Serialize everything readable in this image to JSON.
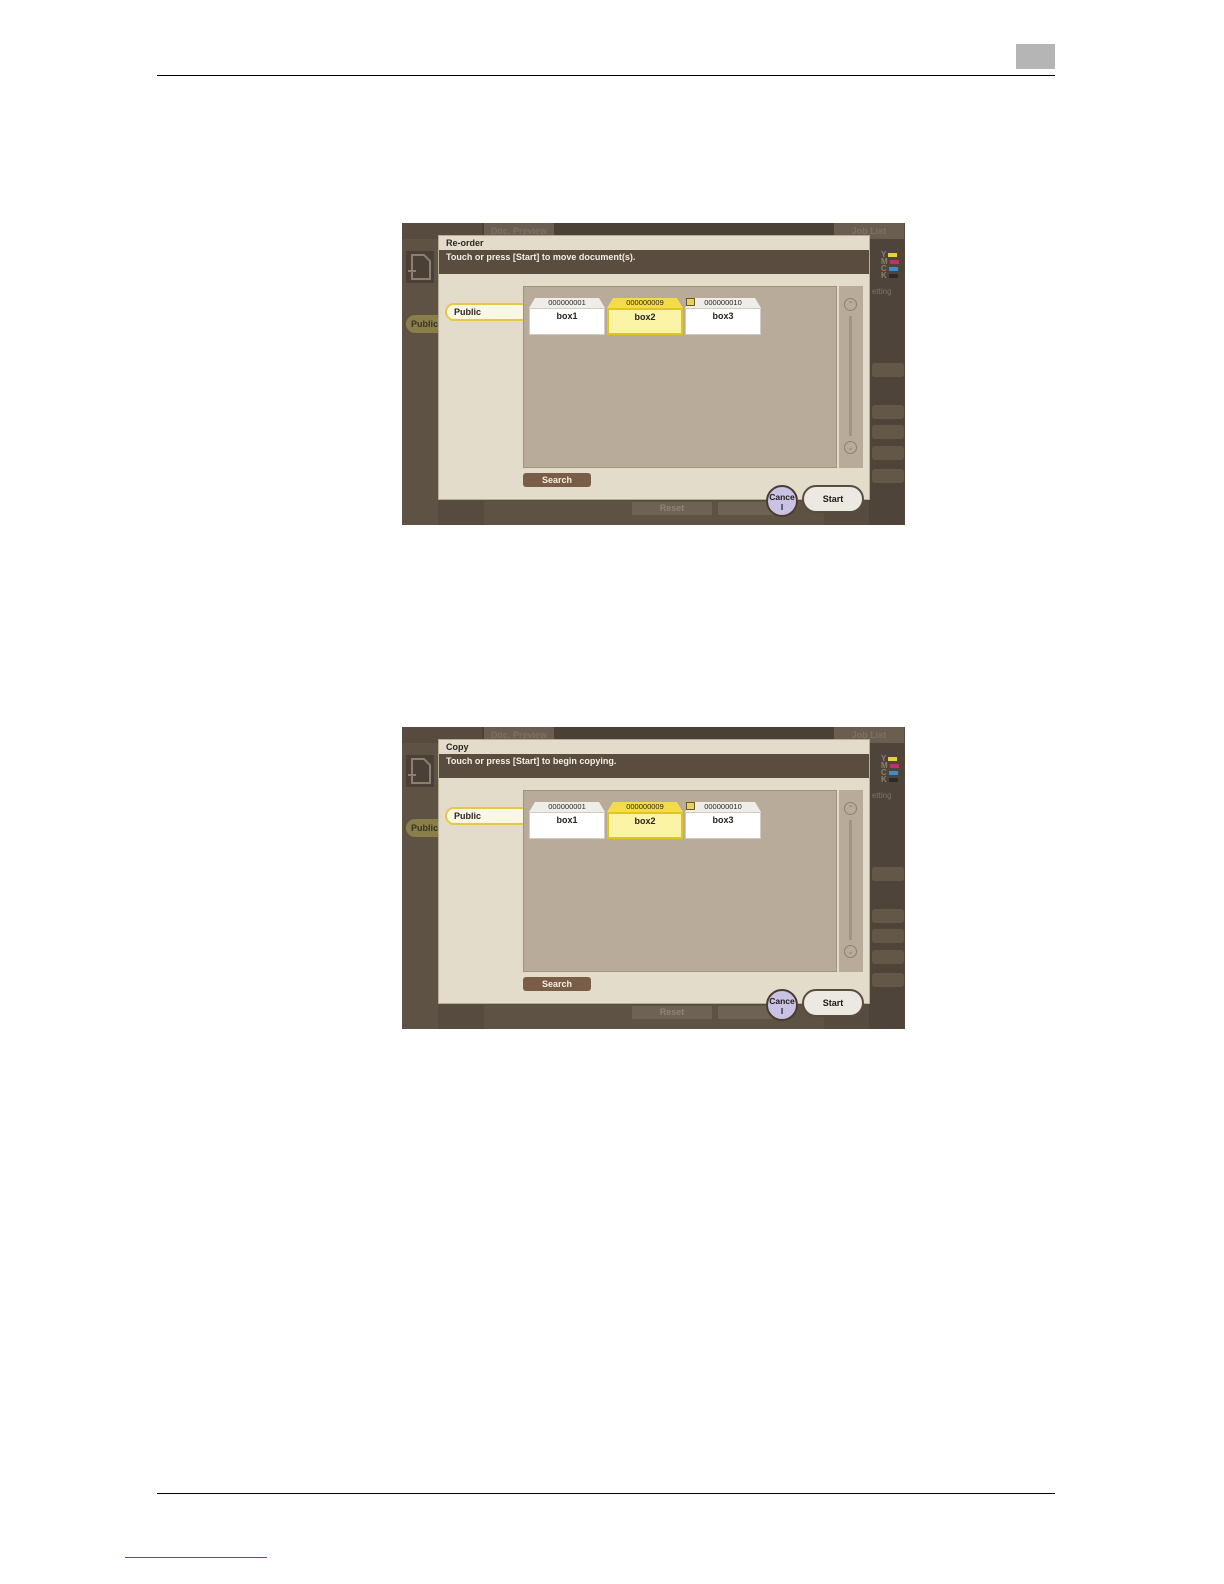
{
  "page": {
    "header_rule": true,
    "footer_rule": true
  },
  "screens": [
    {
      "background": {
        "doc_preview_tab": "Doc. Preview",
        "job_list_tab": "Job List",
        "public_tab": "Public",
        "setting_label": "etting",
        "reset_button": "Reset",
        "ymck": [
          "Y",
          "M",
          "C",
          "K"
        ]
      },
      "dialog": {
        "title": "Re-order",
        "message": "Touch or press [Start] to move document(s).",
        "public_tab": "Public",
        "boxes": [
          {
            "number": "000000001",
            "name": "box1",
            "selected": false
          },
          {
            "number": "000000009",
            "name": "box2",
            "selected": true
          },
          {
            "number": "000000010",
            "name": "box3",
            "selected": false
          }
        ],
        "search_button": "Search",
        "cancel_button": "Cance l",
        "start_button": "Start"
      }
    },
    {
      "background": {
        "doc_preview_tab": "Doc. Preview",
        "job_list_tab": "Job List",
        "public_tab": "Public",
        "setting_label": "etting",
        "reset_button": "Reset",
        "ymck": [
          "Y",
          "M",
          "C",
          "K"
        ]
      },
      "dialog": {
        "title": "Copy",
        "message": "Touch or press [Start] to begin copying.",
        "public_tab": "Public",
        "boxes": [
          {
            "number": "000000001",
            "name": "box1",
            "selected": false
          },
          {
            "number": "000000009",
            "name": "box2",
            "selected": true
          },
          {
            "number": "000000010",
            "name": "box3",
            "selected": false
          }
        ],
        "search_button": "Search",
        "cancel_button": "Cance l",
        "start_button": "Start"
      }
    }
  ],
  "colors": {
    "ymck_swatches": [
      "#e8d23a",
      "#c0306a",
      "#3a8ed0",
      "#2a2a2a"
    ],
    "selected_box": "#fbf3a6",
    "dialog_message_bar": "#5a4c3f"
  }
}
